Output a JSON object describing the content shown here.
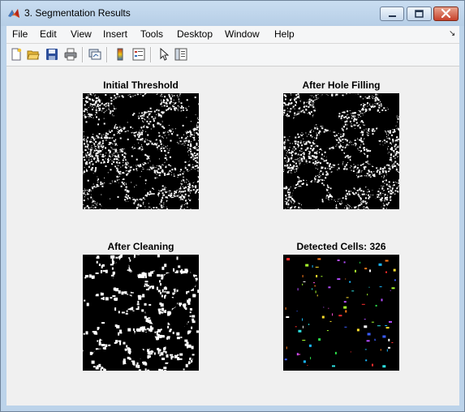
{
  "window": {
    "title": "3. Segmentation Results",
    "app_icon": "matlab-icon"
  },
  "menu": {
    "items": [
      "File",
      "Edit",
      "View",
      "Insert",
      "Tools",
      "Desktop",
      "Window",
      "Help"
    ]
  },
  "toolbar": {
    "icons": [
      "new-figure-icon",
      "open-file-icon",
      "save-icon",
      "print-icon",
      "link-plot-icon",
      "colorbar-icon",
      "legend-icon",
      "pointer-icon",
      "property-editor-icon"
    ]
  },
  "panels": [
    {
      "title": "Initial Threshold",
      "style": "threshold"
    },
    {
      "title": "After Hole Filling",
      "style": "filled"
    },
    {
      "title": "After Cleaning",
      "style": "cleaned"
    },
    {
      "title": "Detected Cells: 326",
      "style": "labeled"
    }
  ],
  "colors": {
    "title_bar": "#bcd3ea",
    "figure_bg": "#f0f0f0",
    "close_button": "#c7412a"
  }
}
